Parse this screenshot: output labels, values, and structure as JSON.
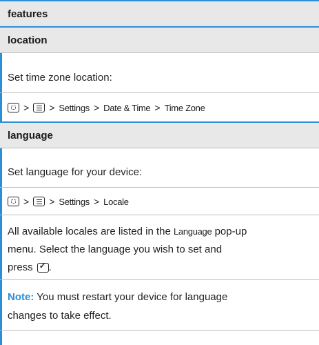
{
  "header": {
    "title": "features"
  },
  "sections": [
    {
      "heading": "location",
      "description": "Set time zone location:",
      "path": [
        "Settings",
        "Date & Time",
        "Time Zone"
      ]
    },
    {
      "heading": "language",
      "description": "Set language for your device:",
      "path": [
        "Settings",
        "Locale"
      ],
      "body_line1_pre": "All available locales are listed in the ",
      "body_line1_bold": "Language",
      "body_line1_post": " pop-up",
      "body_line2": "menu. Select the language you wish to set and",
      "body_line3": "press",
      "body_line3_end": ".",
      "note_label": "Note:",
      "note_line1": " You must restart your device for language",
      "note_line2": "changes to take effect."
    }
  ],
  "separator": ">",
  "icons": [
    "home-key-icon",
    "menu-key-icon",
    "ok-key-icon"
  ],
  "colors": {
    "accent": "#2b8fd8",
    "header_bg": "#e8e8e8"
  }
}
